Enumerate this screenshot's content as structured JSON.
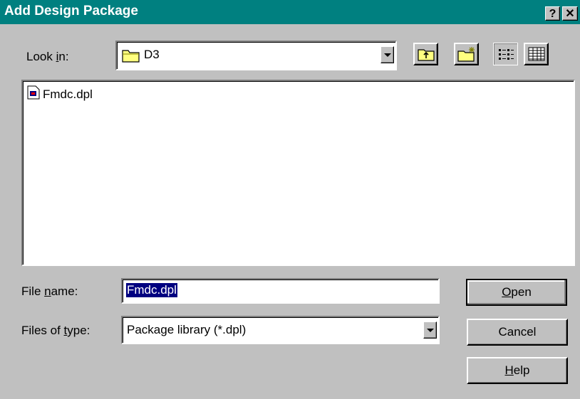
{
  "window": {
    "title": "Add Design Package"
  },
  "caption_buttons": {
    "help": "?",
    "close": "✕"
  },
  "look_in": {
    "label_pre": "Look ",
    "label_ul": "i",
    "label_post": "n:",
    "value": "D3"
  },
  "file_list": {
    "items": [
      {
        "name": "Fmdc.dpl"
      }
    ]
  },
  "file_name": {
    "label_pre": "File ",
    "label_ul": "n",
    "label_post": "ame:",
    "value": "Fmdc.dpl"
  },
  "file_type": {
    "label_pre": "Files of ",
    "label_ul": "t",
    "label_post": "ype:",
    "value": "Package library  (*.dpl)"
  },
  "buttons": {
    "open": {
      "ul": "O",
      "rest": "pen"
    },
    "cancel": {
      "text": "Cancel"
    },
    "help": {
      "ul": "H",
      "rest": "elp"
    }
  },
  "toolbar": {
    "up_icon": "up-one-level-icon",
    "new_folder_icon": "new-folder-icon",
    "list_icon": "list-view-icon",
    "details_icon": "details-view-icon"
  },
  "colors": {
    "titlebar": "#008080",
    "face": "#c0c0c0",
    "selection": "#000080"
  }
}
